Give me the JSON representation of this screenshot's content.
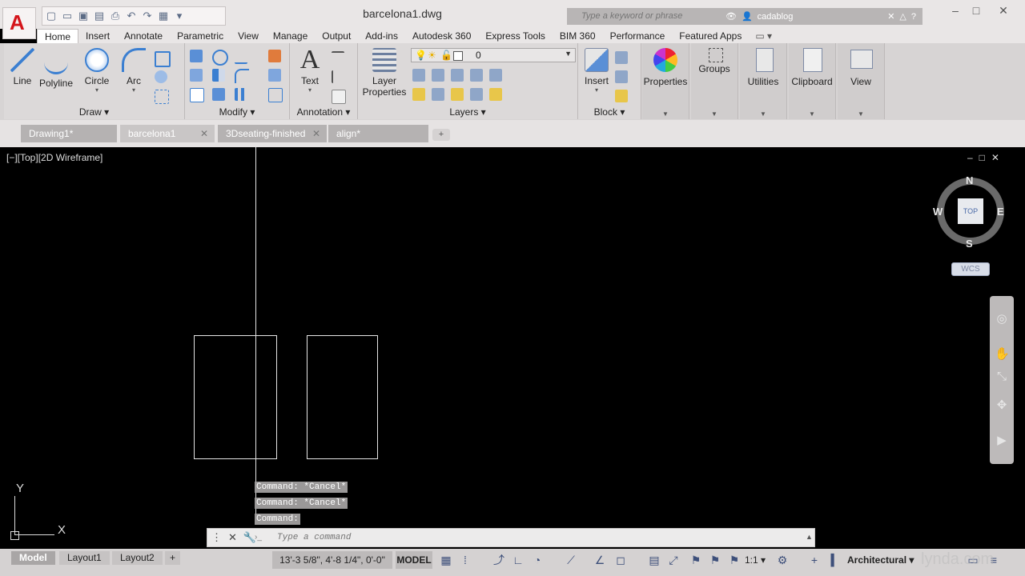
{
  "window": {
    "title": "barcelona1.dwg",
    "search_placeholder": "Type a keyword or phrase",
    "user": "cadablog",
    "controls": [
      "–",
      "□",
      "✕"
    ]
  },
  "app_button": {
    "letter": "A"
  },
  "ribbon_tabs": [
    "Home",
    "Insert",
    "Annotate",
    "Parametric",
    "View",
    "Manage",
    "Output",
    "Add-ins",
    "Autodesk 360",
    "Express Tools",
    "BIM 360",
    "Performance",
    "Featured Apps"
  ],
  "ribbon_tab_extra": "▭ ▾",
  "ribbon": {
    "draw": {
      "title": "Draw ▾",
      "tools": [
        "Line",
        "Polyline",
        "Circle",
        "Arc"
      ]
    },
    "modify": {
      "title": "Modify ▾"
    },
    "annotation": {
      "title": "Annotation ▾",
      "tools": [
        "Text"
      ]
    },
    "layers": {
      "title": "Layers ▾",
      "tool_line1": "Layer",
      "tool_line2": "Properties",
      "current_layer": "0"
    },
    "block": {
      "title": "Block ▾",
      "tools": [
        "Insert"
      ]
    },
    "side_panels": [
      "Properties",
      "Groups",
      "Utilities",
      "Clipboard",
      "View"
    ]
  },
  "file_tabs": [
    {
      "label": "Drawing1*",
      "active": false
    },
    {
      "label": "barcelona1",
      "active": true
    },
    {
      "label": "3Dseating-finished",
      "active": false
    },
    {
      "label": "align*",
      "active": false
    }
  ],
  "viewport": {
    "label": "[−][Top][2D Wireframe]",
    "controls": "–□✕"
  },
  "viewcube": {
    "face": "TOP",
    "north": "N",
    "south": "S",
    "east": "E",
    "west": "W",
    "wcs": "WCS"
  },
  "command_history": [
    "Command: *Cancel*",
    "Command: *Cancel*",
    "Command:"
  ],
  "command_input": {
    "placeholder": "Type a command"
  },
  "ucs": {
    "x": "X",
    "y": "Y"
  },
  "status": {
    "layout_tabs": [
      "Model",
      "Layout1",
      "Layout2"
    ],
    "coords": "13'-3 5/8\", 4'-8 1/4\", 0'-0\"",
    "model": "MODEL",
    "scale": "1:1 ▾",
    "units": "Architectural ▾"
  },
  "watermark": "lynda.com",
  "colors": {
    "ribbon_bg": "#d7d4d4",
    "tab_active": "#ffffff",
    "canvas": "#000000",
    "accent_red": "#d4151b"
  }
}
